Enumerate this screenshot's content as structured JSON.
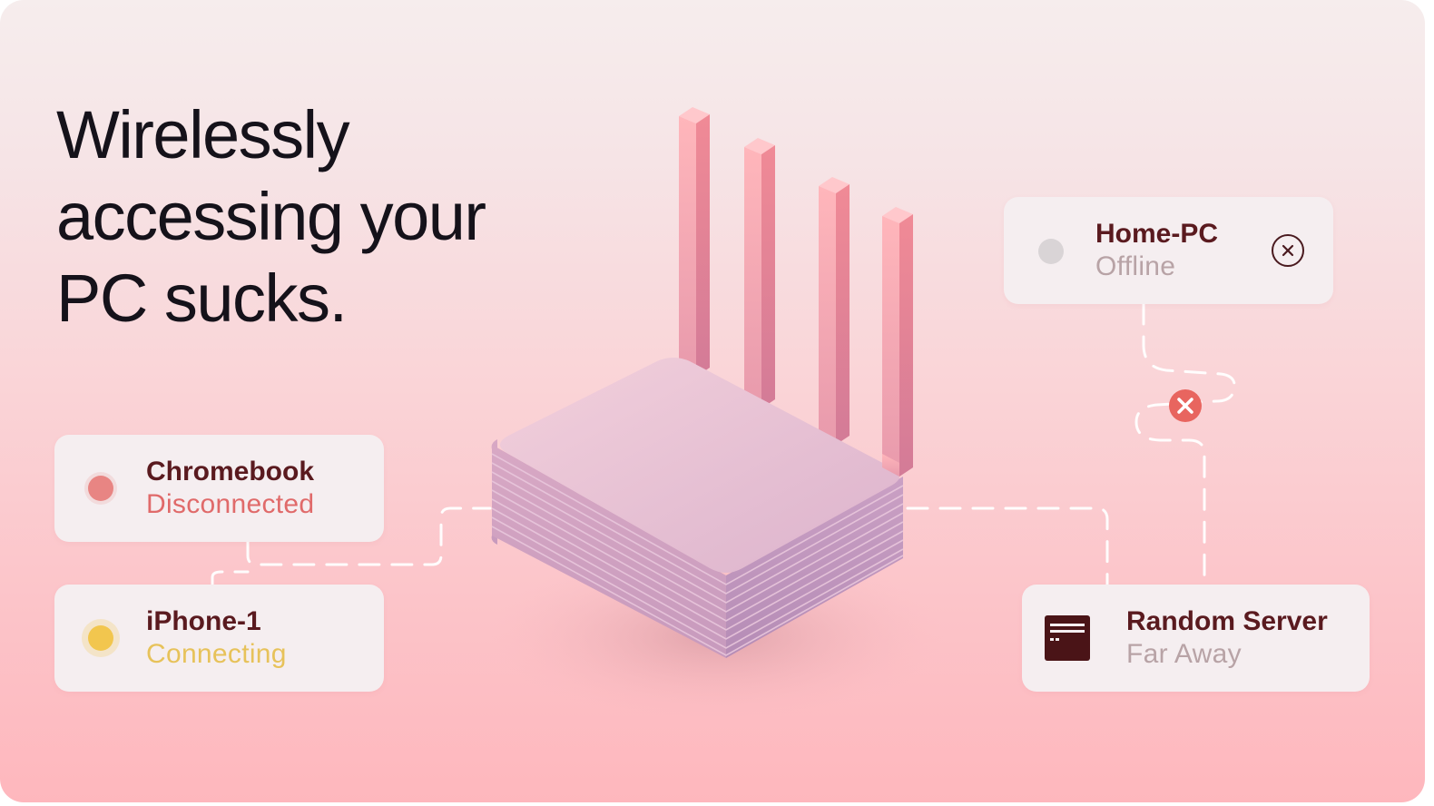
{
  "headline": {
    "line1": "Wirelessly",
    "line2": "accessing your",
    "line3": "PC sucks."
  },
  "devices": {
    "chromebook": {
      "name": "Chromebook",
      "status": "Disconnected",
      "status_color": "#e06a6a",
      "dot_color": "#e88583"
    },
    "iphone": {
      "name": "iPhone-1",
      "status": "Connecting",
      "status_color": "#e7c25a",
      "dot_color": "#f2c64e"
    },
    "home_pc": {
      "name": "Home-PC",
      "status": "Offline",
      "status_color": "#b8a3a6",
      "dot_color": "#d9d4d6",
      "action_icon": "close-circle-icon"
    },
    "server": {
      "name": "Random Server",
      "status": "Far Away",
      "status_color": "#b8a3a6",
      "icon": "server-window-icon"
    }
  },
  "colors": {
    "name_text": "#5a1a1f",
    "connection_line": "#ffffff",
    "error_marker": "#e8655f"
  }
}
